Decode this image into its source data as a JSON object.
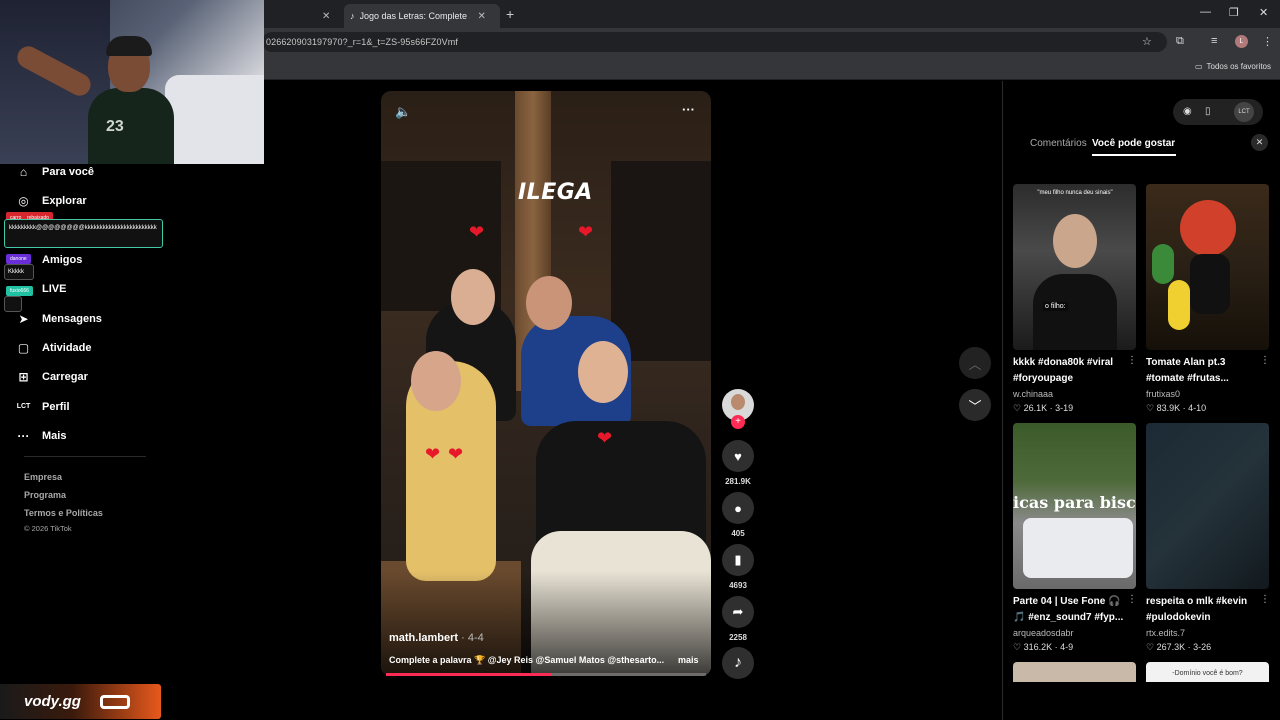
{
  "browser": {
    "tabs": [
      {
        "label": ""
      },
      {
        "label": "Jogo das Letras: Complete a Pa"
      }
    ],
    "url": "026620903197970?_r=1&_t=ZS-95s66FZ0Vmf",
    "bookmarks_label": "Todos os favoritos",
    "profile_initial": "L"
  },
  "sidebar": {
    "items": [
      {
        "label": "Para você",
        "icon": "home-icon"
      },
      {
        "label": "Explorar",
        "icon": "compass-icon"
      },
      {
        "label": "Amigos",
        "icon": "friends-icon"
      },
      {
        "label": "LIVE",
        "icon": "live-icon"
      },
      {
        "label": "Mensagens",
        "icon": "send-icon"
      },
      {
        "label": "Atividade",
        "icon": "activity-icon"
      },
      {
        "label": "Carregar",
        "icon": "upload-icon"
      },
      {
        "label": "Perfil",
        "icon": "profile-icon"
      },
      {
        "label": "Mais",
        "icon": "more-icon"
      }
    ],
    "footer_links": [
      "Empresa",
      "Programa",
      "Termos e Políticas"
    ],
    "copyright": "© 2026 TikTok"
  },
  "overlay_chat": {
    "user1": "carro__rebaixado",
    "msg1": "kkkkkkkkk@@@@@@@@kkkkkkkkkkkkkkkkkkkkkkkk",
    "user2": "danone",
    "msg2": "Kkkkk",
    "user3": "fuxio666"
  },
  "stream_brand": "vody.gg",
  "video": {
    "overlay_text": "ILEGA",
    "creator": "math.lambert",
    "date": "4-4",
    "caption": "Complete a palavra 🏆 @Jey Reis @Samuel Matos @sthesarto...",
    "more_label": "mais",
    "progress": 0.52
  },
  "actions": {
    "likes": "281.9K",
    "comments": "405",
    "saves": "4693",
    "shares": "2258"
  },
  "right_panel": {
    "tab_comments": "Comentários",
    "tab_suggestions": "Você pode gostar",
    "cards": [
      {
        "title": "kkkk #dona80k #viral #foryoupage",
        "author": "w.chinaaa",
        "likes": "26.1K",
        "date": "3-19",
        "thumb_text1": "\"meu filho nunca deu sinais\"",
        "thumb_text2": "o filho:"
      },
      {
        "title": "Tomate Alan pt.3 #tomate #frutas...",
        "author": "frutixas0",
        "likes": "83.9K",
        "date": "4-10"
      },
      {
        "title": "Parte 04 | Use Fone 🎧 🎵 #enz_sound7 #fyp...",
        "author": "arqueadosdabr",
        "likes": "316.2K",
        "date": "4-9",
        "thumb_text1": "icas para bisco"
      },
      {
        "title": "respeita o mlk #kevin #pulodokevin",
        "author": "rtx.edits.7",
        "likes": "267.3K",
        "date": "3-26"
      }
    ],
    "bottom_thumb_text": "-Domínio você é bom?"
  }
}
